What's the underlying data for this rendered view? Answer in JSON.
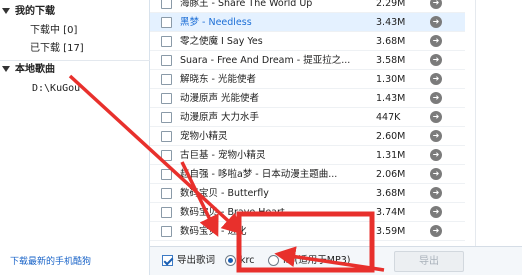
{
  "left_tree": {
    "my_downloads": "我的下载",
    "downloading": "下载中 [0]",
    "downloaded": "已下载 [17]",
    "local_songs": "本地歌曲",
    "local_path": "D:\\KuGou"
  },
  "bottom_link": "下载最新的手机酷狗",
  "songs": [
    {
      "title": "海豚王 - Share The World Up",
      "size": "2.29M"
    },
    {
      "title": "黑梦 - Needless",
      "size": "3.43M"
    },
    {
      "title": "零之使魔 I Say Yes",
      "size": "3.68M"
    },
    {
      "title": "Suara - Free And Dream - 提亚拉之...",
      "size": "3.58M"
    },
    {
      "title": "解晓东 - 光能使者",
      "size": "1.30M"
    },
    {
      "title": "动漫原声 光能使者",
      "size": "1.43M"
    },
    {
      "title": "动漫原声 大力水手",
      "size": "447K"
    },
    {
      "title": "宠物小精灵",
      "size": "2.60M"
    },
    {
      "title": "古巨基 - 宠物小精灵",
      "size": "1.31M"
    },
    {
      "title": "赵自强 - 哆啦a梦 - 日本动漫主题曲...",
      "size": "2.06M"
    },
    {
      "title": "数码宝贝 - Butterfly",
      "size": "3.68M"
    },
    {
      "title": "数码宝贝 - Brave Heart",
      "size": "3.74M"
    },
    {
      "title": "数码宝贝 - 进化",
      "size": "3.59M"
    }
  ],
  "selected_row": 1,
  "bottom_bar": {
    "export_lyrics": "导出歌词",
    "krc_label": "krc",
    "lrc_label": "lrc(适用于MP3)",
    "export_button": "导出"
  },
  "colors": {
    "annotation": "#e8302c",
    "link": "#1a64c8",
    "selected_row": "#e4f1ff"
  }
}
